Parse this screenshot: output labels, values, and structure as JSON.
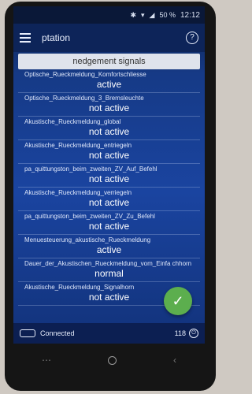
{
  "status_bar": {
    "battery": "50 %",
    "time": "12:12"
  },
  "app_bar": {
    "title": "ptation"
  },
  "section_title": "nedgement signals",
  "items": [
    {
      "name": "Optische_Rueckmeldung_Komfortschliesse",
      "value": "active"
    },
    {
      "name": "Optische_Rueckmeldung_3_Bremsleuchte",
      "value": "not active"
    },
    {
      "name": "Akustische_Rueckmeldung_global",
      "value": "not active"
    },
    {
      "name": "Akustische_Rueckmeldung_entriegeln",
      "value": "not active"
    },
    {
      "name": "pa_quittungston_beim_zweiten_ZV_Auf_Befehl",
      "value": "not active"
    },
    {
      "name": "Akustische_Rueckmeldung_verriegeln",
      "value": "not active"
    },
    {
      "name": "pa_quittungston_beim_zweiten_ZV_Zu_Befehl",
      "value": "not active"
    },
    {
      "name": "Menuesteuerung_akustische_Rueckmeldung",
      "value": "active"
    },
    {
      "name": "Dauer_der_Akustischen_Rueckmeldung_vom_Einfa chhorn",
      "value": "normal"
    },
    {
      "name": "Akustische_Rueckmeldung_Signalhorn",
      "value": "not active"
    }
  ],
  "bottom_bar": {
    "status": "Connected",
    "count": "118"
  },
  "icons": {
    "menu": "hamburger-icon",
    "help": "help-icon",
    "confirm": "checkmark-icon",
    "car": "car-icon",
    "exit": "exit-icon"
  }
}
